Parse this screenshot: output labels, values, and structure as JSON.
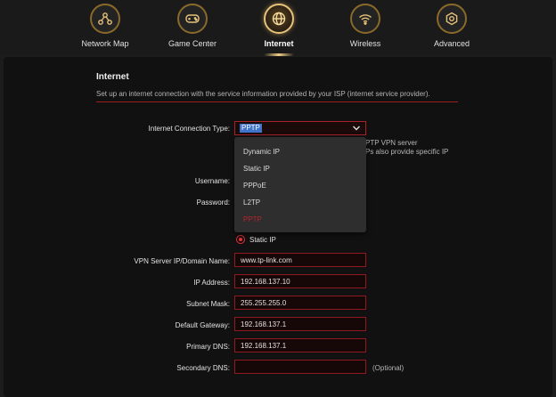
{
  "nav": {
    "items": [
      {
        "label": "Network Map",
        "icon": "network-map-icon"
      },
      {
        "label": "Game Center",
        "icon": "gamepad-icon"
      },
      {
        "label": "Internet",
        "icon": "globe-icon",
        "active": true
      },
      {
        "label": "Wireless",
        "icon": "wifi-icon"
      },
      {
        "label": "Advanced",
        "icon": "gear-icon"
      }
    ]
  },
  "section": {
    "title": "Internet",
    "description": "Set up an internet connection with the service information provided by your ISP (internet service provider)."
  },
  "form": {
    "connection_type_label": "Internet Connection Type:",
    "connection_type_value": "PPTP",
    "hint_line1": "PTP VPN server",
    "hint_line2": "Ps also provide specific IP",
    "username_label": "Username:",
    "password_label": "Password:",
    "static_ip_radio_label": "Static IP",
    "vpn_server_label": "VPN Server IP/Domain Name:",
    "vpn_server_value": "www.tp-link.com",
    "ip_address_label": "IP Address:",
    "ip_address_value": "192.168.137.10",
    "subnet_mask_label": "Subnet Mask:",
    "subnet_mask_value": "255.255.255.0",
    "default_gateway_label": "Default Gateway:",
    "default_gateway_value": "192.168.137.1",
    "primary_dns_label": "Primary DNS:",
    "primary_dns_value": "192.168.137.1",
    "secondary_dns_label": "Secondary DNS:",
    "secondary_dns_value": "",
    "optional_label": "(Optional)"
  },
  "dropdown": {
    "options": [
      "Dynamic IP",
      "Static IP",
      "PPPoE",
      "L2TP",
      "PPTP"
    ],
    "selected": "PPTP"
  },
  "colors": {
    "accent_red": "#a8222a",
    "accent_gold": "#e6c27a",
    "selection_blue": "#3f74c9"
  }
}
